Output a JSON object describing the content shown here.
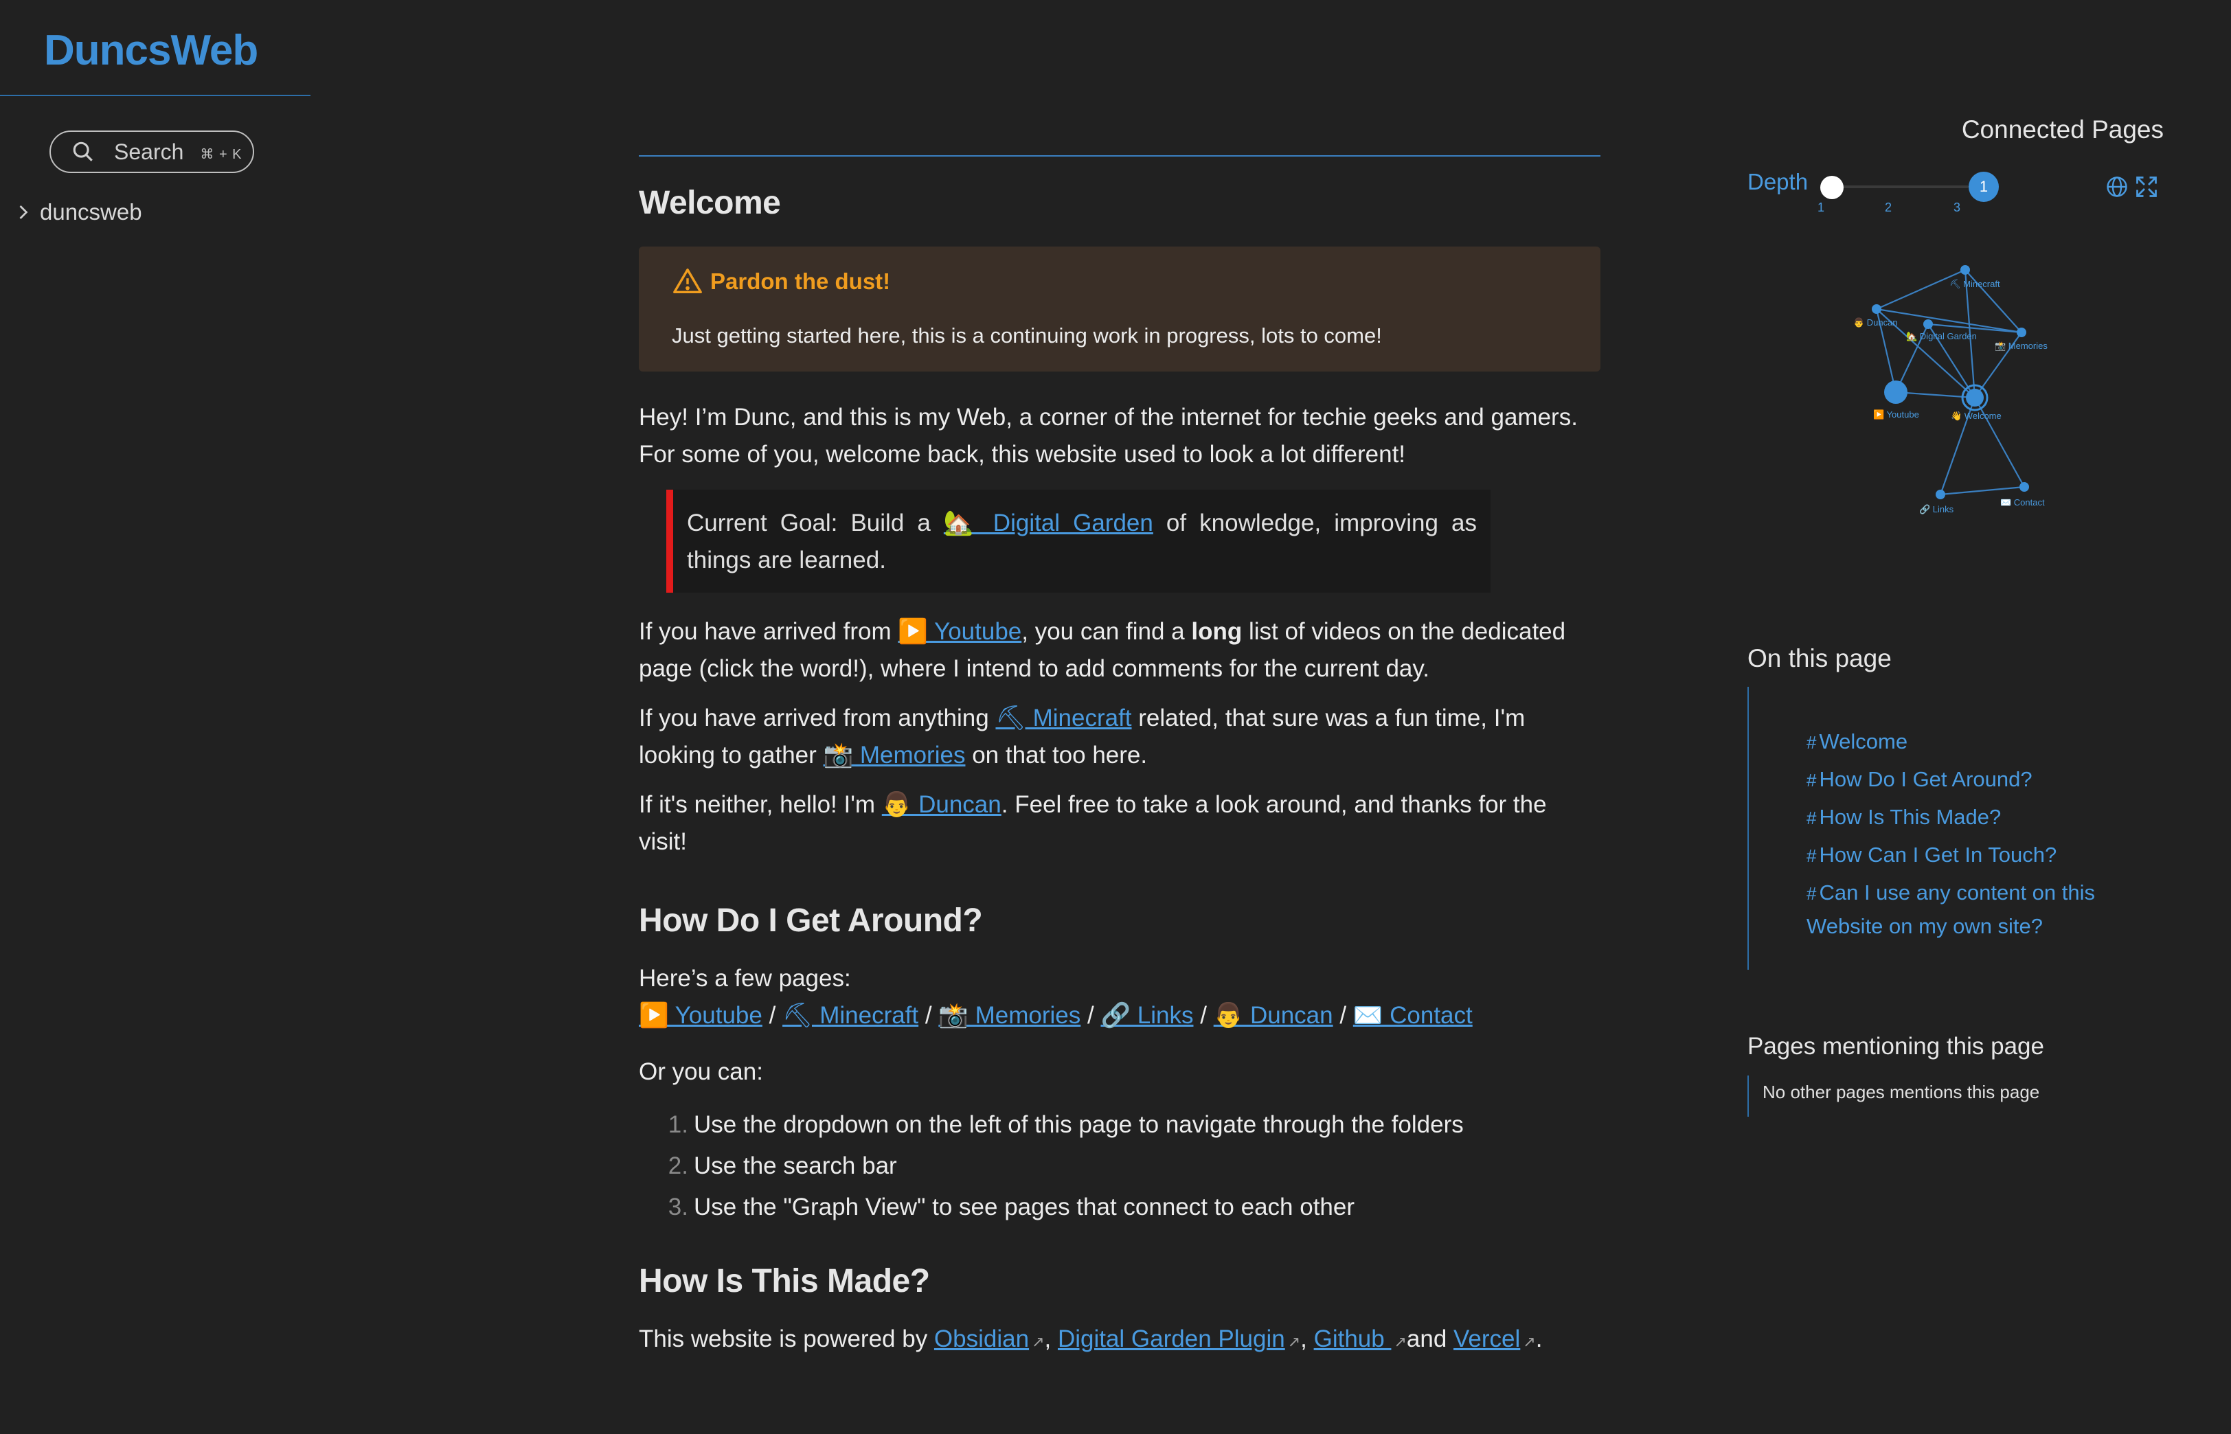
{
  "site": {
    "title": "DuncsWeb"
  },
  "search": {
    "label": "Search",
    "shortcut": "⌘ + K"
  },
  "explorer": {
    "items": [
      {
        "label": "duncsweb"
      }
    ]
  },
  "article": {
    "title": "Welcome",
    "callout": {
      "title": "Pardon the dust!",
      "body": "Just getting started here, this is a continuing work in progress, lots to come!"
    },
    "intro": [
      "Hey! I’m Dunc, and this is my Web, a corner of the internet for techie geeks and gamers. For some of you, welcome back, this website used to look a lot different!"
    ],
    "quote": {
      "before": "Current Goal: Build a ",
      "link": "🏡 Digital Garden",
      "after": " of knowledge, improving as things are learned."
    },
    "youtube_para": {
      "before": "If you have arrived from ",
      "link": "▶️ Youtube",
      "mid": ", you can find a ",
      "bold": "long",
      "after": " list of videos on the dedicated page (click the word!), where I intend to add comments for the current day."
    },
    "minecraft_para": {
      "before": "If you have arrived from anything ",
      "link1": "⛏ Minecraft",
      "mid": " related, that sure was a fun time, I'm looking to gather ",
      "link2": "📸 Memories",
      "after": " on that too here."
    },
    "hello_para": {
      "before": "If it's neither, hello! I'm ",
      "link": "👨 Duncan",
      "after": ". Feel free to take a look around, and thanks for the visit!"
    },
    "around": {
      "heading": "How Do I Get Around?",
      "intro": "Here’s a few pages:",
      "links": [
        "▶️ Youtube",
        "⛏ Minecraft",
        "📸 Memories",
        "🔗 Links",
        "👨 Duncan",
        "✉️ Contact"
      ],
      "separator": " / ",
      "or": "Or you can:",
      "steps": [
        "Use the dropdown on the left of this page to navigate through the folders",
        "Use the search bar",
        "Use the \"Graph View\" to see pages that connect to each other"
      ],
      "step_numbers": [
        "1.",
        "2.",
        "3."
      ]
    },
    "made": {
      "heading": "How Is This Made?",
      "before": "This website is powered by ",
      "links": [
        "Obsidian",
        "Digital Garden Plugin",
        "Github ",
        "Vercel"
      ],
      "sep1": ", ",
      "sep2": ", ",
      "sep3": "and ",
      "end": "."
    }
  },
  "graph_panel": {
    "title": "Connected Pages",
    "depth_label": "Depth",
    "depth_value": "1",
    "ticks": [
      "1",
      "2",
      "3"
    ],
    "nodes": [
      {
        "id": "minecraft",
        "label": "⛏ Minecraft"
      },
      {
        "id": "duncan",
        "label": "👨 Duncan"
      },
      {
        "id": "garden",
        "label": "🏡 Digital Garden"
      },
      {
        "id": "memories",
        "label": "📸 Memories"
      },
      {
        "id": "youtube",
        "label": "▶️ Youtube"
      },
      {
        "id": "welcome",
        "label": "👋 Welcome"
      },
      {
        "id": "links",
        "label": "🔗 Links"
      },
      {
        "id": "contact",
        "label": "✉️ Contact"
      }
    ]
  },
  "toc": {
    "title": "On this page",
    "items": [
      "Welcome",
      "How Do I Get Around?",
      "How Is This Made?",
      "How Can I Get In Touch?",
      "Can I use any content on this Website on my own site?"
    ],
    "hash": "#"
  },
  "mentions": {
    "title": "Pages mentioning this page",
    "empty_text": "No other pages mentions this page"
  },
  "colors": {
    "background": "#212121",
    "accent": "#4a9be0",
    "callout_bg": "#3a2f27",
    "callout_title": "#f09d1f",
    "quote_border": "#e21b1b"
  }
}
